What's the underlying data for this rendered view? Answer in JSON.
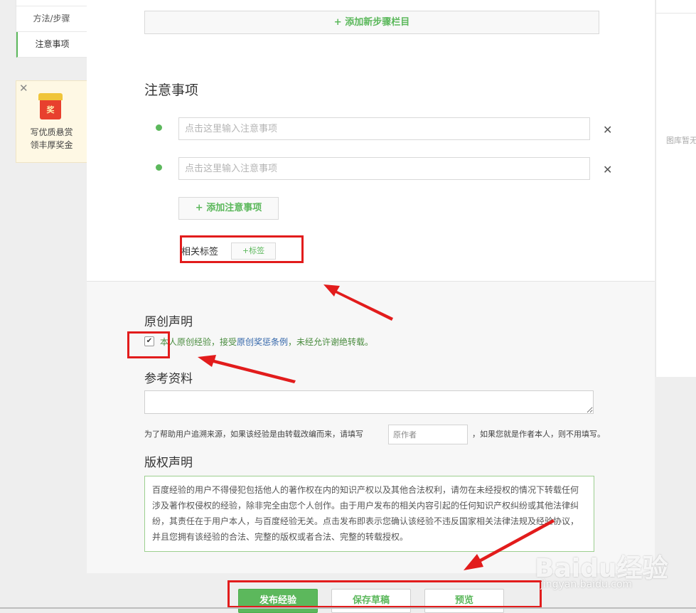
{
  "left_nav": {
    "items": [
      {
        "label": "方法/步骤"
      },
      {
        "label": "注意事项"
      }
    ]
  },
  "promo": {
    "badge": "奖",
    "line1": "写优质悬赏",
    "line2": "领丰厚奖金",
    "close_glyph": "✕"
  },
  "right_panel": {
    "gallery_text": "图库暂无"
  },
  "steps": {
    "add_step_label": "+ 添加新步骤栏目"
  },
  "notes": {
    "title": "注意事项",
    "items": [
      {
        "placeholder": "点击这里输入注意事项",
        "value": ""
      },
      {
        "placeholder": "点击这里输入注意事项",
        "value": ""
      }
    ],
    "delete_glyph": "✕",
    "add_note_label": "+ 添加注意事项"
  },
  "tags": {
    "label": "相关标签",
    "add_tag_label": "+标签"
  },
  "original": {
    "title": "原创声明",
    "checked": true,
    "check_glyph": "✔",
    "text_prefix": "本人原创经验，接受",
    "link": "原创奖惩条例",
    "text_suffix": "，未经允许谢绝转载。"
  },
  "reference": {
    "title": "参考资料",
    "hint_before": "为了帮助用户追溯来源，如果该经验是由转载改编而来，请填写",
    "author_placeholder": "原作者",
    "hint_after": "，如果您就是作者本人，则不用填写。"
  },
  "copyright": {
    "title": "版权声明",
    "text": "百度经验的用户不得侵犯包括他人的著作权在内的知识产权以及其他合法权利，请勿在未经授权的情况下转载任何涉及著作权侵权的经验，除非完全由您个人创作。由于用户发布的相关内容引起的任何知识产权纠纷或其他法律纠纷，其责任在于用户本人，与百度经验无关。点击发布即表示您确认该经验不违反国家相关法律法规及经验协议，并且您拥有该经验的合法、完整的版权或者合法、完整的转载授权。"
  },
  "actions": {
    "publish": "发布经验",
    "save_draft": "保存草稿",
    "preview": "预览"
  },
  "watermark": {
    "brand": "Baidu经验",
    "url": "jingyan.baidu.com"
  },
  "colors": {
    "accent_green": "#5cb85c",
    "annotation_red": "#e21c1c"
  }
}
